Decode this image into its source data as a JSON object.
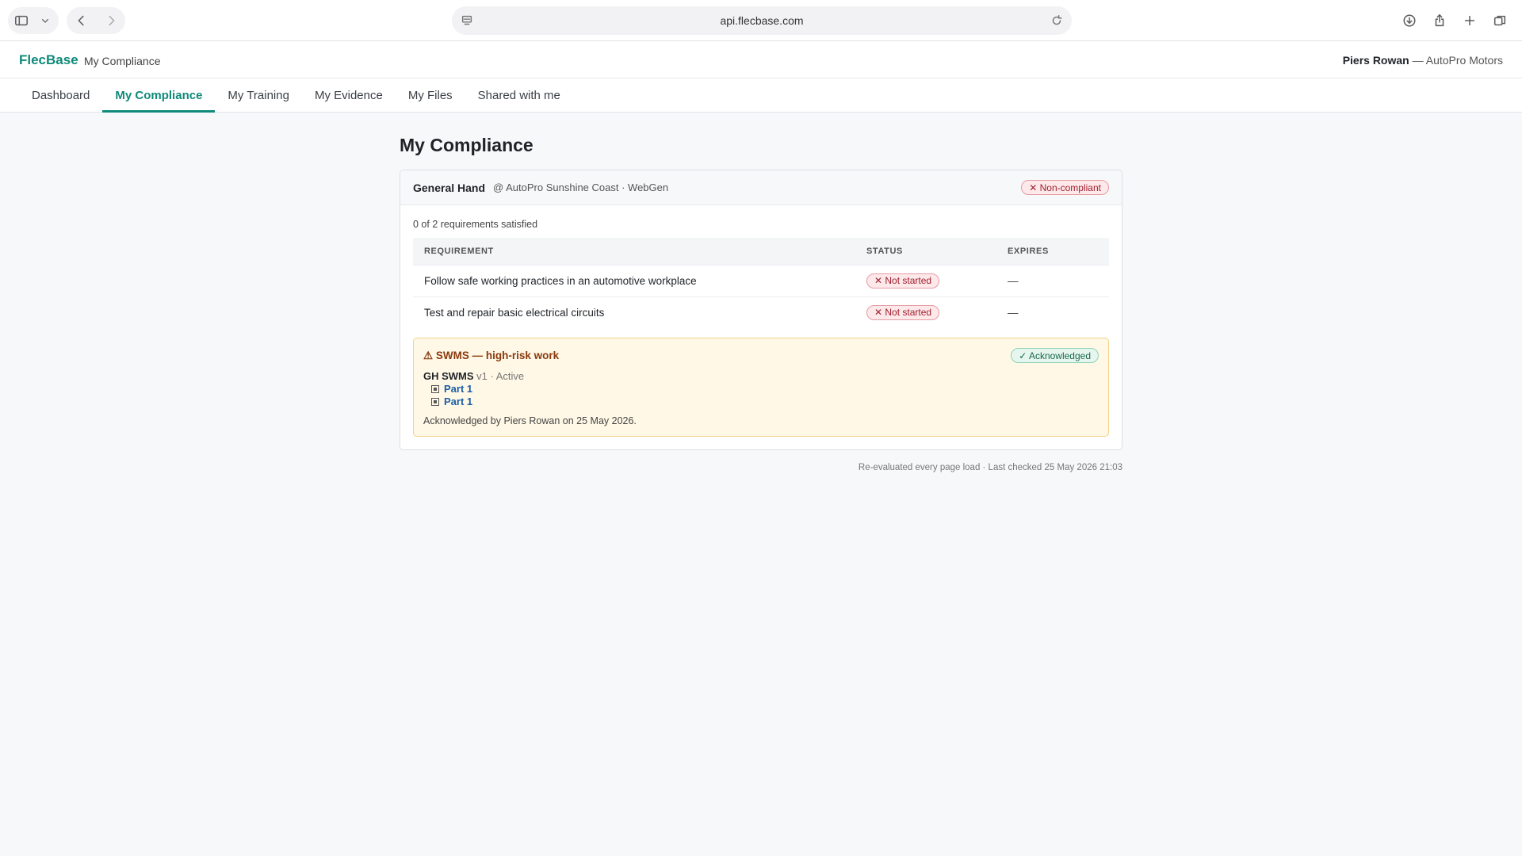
{
  "browser": {
    "url": "api.flecbase.com"
  },
  "header": {
    "brand": "FlecBase",
    "section": "My Compliance",
    "user_name": "Piers Rowan",
    "user_org": " — AutoPro Motors"
  },
  "nav": {
    "tabs": [
      {
        "label": "Dashboard",
        "active": false
      },
      {
        "label": "My Compliance",
        "active": true
      },
      {
        "label": "My Training",
        "active": false
      },
      {
        "label": "My Evidence",
        "active": false
      },
      {
        "label": "My Files",
        "active": false
      },
      {
        "label": "Shared with me",
        "active": false
      }
    ]
  },
  "main": {
    "title": "My Compliance",
    "card": {
      "role": "General Hand",
      "location": "@ AutoPro Sunshine Coast · WebGen",
      "status": "✕ Non-compliant",
      "summary": "0 of 2 requirements satisfied",
      "columns": [
        "REQUIREMENT",
        "STATUS",
        "EXPIRES"
      ],
      "rows": [
        {
          "requirement": "Follow safe working practices in an automotive workplace",
          "status": "✕ Not started",
          "expires": "—"
        },
        {
          "requirement": "Test and repair basic electrical circuits",
          "status": "✕ Not started",
          "expires": "—"
        }
      ],
      "swms": {
        "title": "⚠ SWMS — high-risk work",
        "status": "✓ Acknowledged",
        "doc_name": "GH SWMS",
        "doc_meta": " v1 · Active",
        "parts": [
          "Part 1",
          "Part 1"
        ],
        "ack_note": "Acknowledged by Piers Rowan on 25 May 2026."
      }
    },
    "footer": "Re-evaluated every page load · Last checked 25 May 2026 21:03"
  },
  "colors": {
    "accent": "#0f8a7a",
    "danger": "#a0202e",
    "success": "#176a47",
    "warning_bg": "#fff8e6"
  }
}
